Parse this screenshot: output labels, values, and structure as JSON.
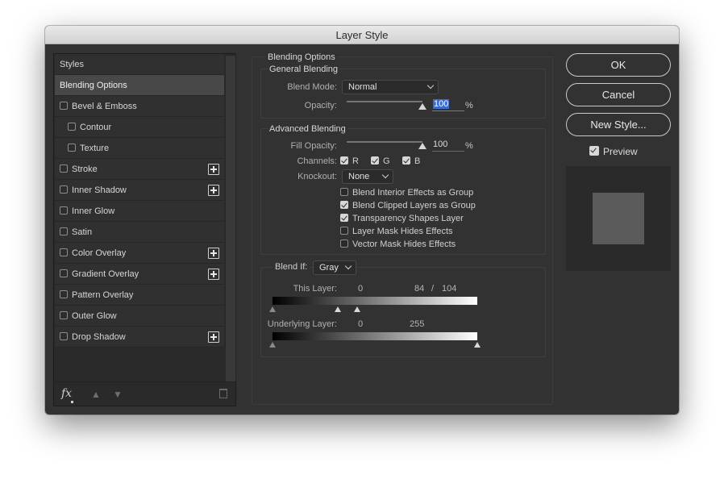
{
  "window": {
    "title": "Layer Style"
  },
  "styles_panel": {
    "items": [
      {
        "label": "Styles",
        "kind": "header"
      },
      {
        "label": "Blending Options",
        "kind": "selected"
      },
      {
        "label": "Bevel & Emboss",
        "checked": false
      },
      {
        "label": "Contour",
        "checked": false,
        "indent": true
      },
      {
        "label": "Texture",
        "checked": false,
        "indent": true
      },
      {
        "label": "Stroke",
        "checked": false,
        "plus": true
      },
      {
        "label": "Inner Shadow",
        "checked": false,
        "plus": true
      },
      {
        "label": "Inner Glow",
        "checked": false
      },
      {
        "label": "Satin",
        "checked": false
      },
      {
        "label": "Color Overlay",
        "checked": false,
        "plus": true
      },
      {
        "label": "Gradient Overlay",
        "checked": false,
        "plus": true
      },
      {
        "label": "Pattern Overlay",
        "checked": false
      },
      {
        "label": "Outer Glow",
        "checked": false
      },
      {
        "label": "Drop Shadow",
        "checked": false,
        "plus": true
      }
    ],
    "footer": {
      "fx_label": "fx",
      "move_up_icon": "arrow-up-icon",
      "move_down_icon": "arrow-down-icon",
      "delete_icon": "trash-icon"
    }
  },
  "blending_options": {
    "title": "Blending Options",
    "general": {
      "title": "General Blending",
      "blend_mode_label": "Blend Mode:",
      "blend_mode_value": "Normal",
      "opacity_label": "Opacity:",
      "opacity_value": "100",
      "opacity_unit": "%"
    },
    "advanced": {
      "title": "Advanced Blending",
      "fill_opacity_label": "Fill Opacity:",
      "fill_opacity_value": "100",
      "fill_opacity_unit": "%",
      "channels_label": "Channels:",
      "channels": [
        {
          "label": "R",
          "checked": true
        },
        {
          "label": "G",
          "checked": true
        },
        {
          "label": "B",
          "checked": true
        }
      ],
      "knockout_label": "Knockout:",
      "knockout_value": "None",
      "options": [
        {
          "label": "Blend Interior Effects as Group",
          "checked": false
        },
        {
          "label": "Blend Clipped Layers as Group",
          "checked": true
        },
        {
          "label": "Transparency Shapes Layer",
          "checked": true
        },
        {
          "label": "Layer Mask Hides Effects",
          "checked": false
        },
        {
          "label": "Vector Mask Hides Effects",
          "checked": false
        }
      ]
    },
    "blend_if": {
      "label": "Blend If:",
      "value": "Gray",
      "this_layer": {
        "label": "This Layer:",
        "low": "0",
        "high_a": "84",
        "separator": "/",
        "high_b": "104"
      },
      "underlying_layer": {
        "label": "Underlying Layer:",
        "low": "0",
        "high": "255"
      }
    }
  },
  "buttons": {
    "ok": "OK",
    "cancel": "Cancel",
    "new_style": "New Style..."
  },
  "preview": {
    "label": "Preview",
    "checked": true,
    "swatch_color": "#5a5a5a"
  },
  "colors": {
    "selection_highlight": "#3e6ccc",
    "dialog_bg": "#323232"
  }
}
